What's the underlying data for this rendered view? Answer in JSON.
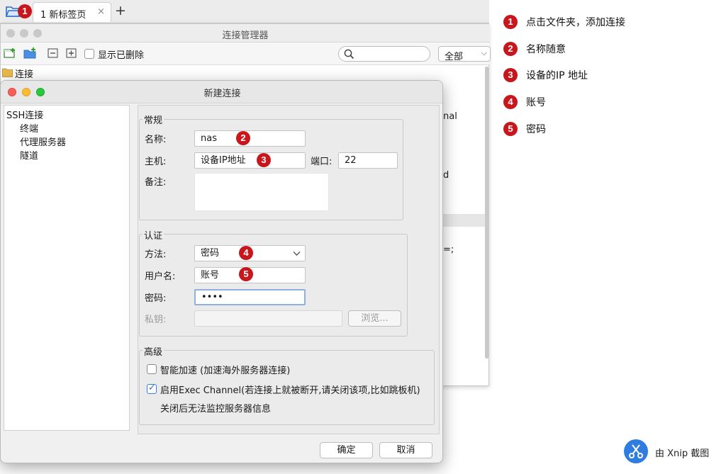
{
  "tabbar": {
    "tab_label": "1 新标签页",
    "tab_close": "×",
    "add_tab": "+",
    "folder_badge": "1"
  },
  "manager": {
    "title": "连接管理器",
    "show_deleted_label": "显示已删除",
    "filter_value": "全部",
    "filter_arrow": "⌵",
    "tree_root_label": "连接",
    "fragments": [
      "nal",
      "d",
      "=;"
    ]
  },
  "dialog": {
    "title": "新建连接",
    "sidebar": {
      "items": [
        "SSH连接",
        "终端",
        "代理服务器",
        "隧道"
      ]
    },
    "general": {
      "title": "常规",
      "name_label": "名称:",
      "name_value": "nas",
      "name_badge": "2",
      "host_label": "主机:",
      "host_value": "设备IP地址",
      "host_badge": "3",
      "port_label": "端口:",
      "port_value": "22",
      "note_label": "备注:",
      "note_value": ""
    },
    "auth": {
      "title": "认证",
      "method_label": "方法:",
      "method_value": "密码",
      "method_badge": "4",
      "user_label": "用户名:",
      "user_value": "账号",
      "user_badge": "5",
      "password_label": "密码:",
      "password_value": "••••",
      "key_label": "私钥:",
      "key_value": "",
      "browse_label": "浏览..."
    },
    "advanced": {
      "title": "高级",
      "smart_accel_label": "智能加速 (加速海外服务器连接)",
      "smart_accel_checked": false,
      "exec_channel_label": "启用Exec Channel(若连接上就被断开,请关闭该项,比如跳板机)",
      "exec_channel_checked": true,
      "exec_channel_note": "关闭后无法监控服务器信息"
    },
    "ok_label": "确定",
    "cancel_label": "取消"
  },
  "annotations": [
    {
      "num": "1",
      "text": "点击文件夹，添加连接"
    },
    {
      "num": "2",
      "text": "名称随意"
    },
    {
      "num": "3",
      "text": "设备的IP 地址"
    },
    {
      "num": "4",
      "text": "账号"
    },
    {
      "num": "5",
      "text": "密码"
    }
  ],
  "watermark": "由 Xnip 截图",
  "colors": {
    "badge": "#c8161d",
    "focus": "#8fb1dc",
    "checkbox_accent": "#2f74d8",
    "xnip_blue": "#2f7de1"
  }
}
